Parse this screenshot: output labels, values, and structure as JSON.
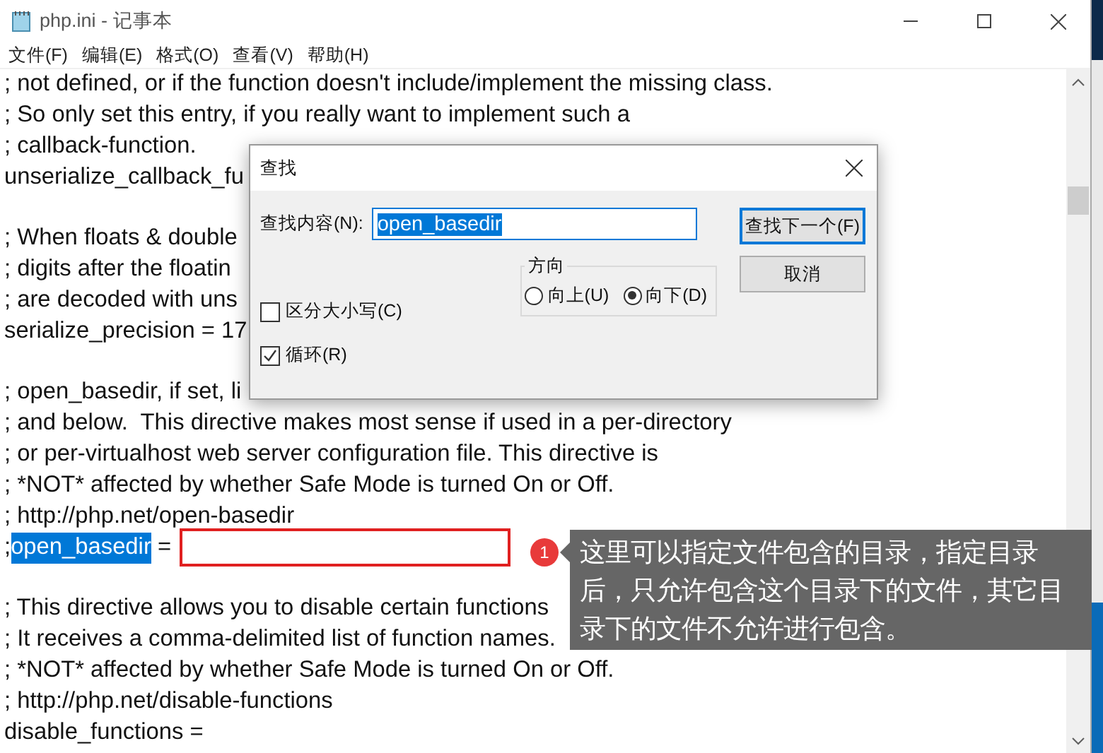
{
  "window": {
    "title": "php.ini - 记事本"
  },
  "menu": [
    "文件(F)",
    "编辑(E)",
    "格式(O)",
    "查看(V)",
    "帮助(H)"
  ],
  "lines": [
    {
      "kind": "text",
      "text": "; not defined, or if the function doesn't include/implement the missing class."
    },
    {
      "kind": "text",
      "text": "; So only set this entry, if you really want to implement such a"
    },
    {
      "kind": "text",
      "text": "; callback-function."
    },
    {
      "kind": "text",
      "text": "unserialize_callback_fu"
    },
    {
      "kind": "blank"
    },
    {
      "kind": "text",
      "text": "; When floats & double"
    },
    {
      "kind": "text",
      "text": "; digits after the floatin"
    },
    {
      "kind": "text",
      "text": "; are decoded with uns"
    },
    {
      "kind": "text",
      "text": "serialize_precision = 17"
    },
    {
      "kind": "blank"
    },
    {
      "kind": "text",
      "text": "; open_basedir, if set, li"
    },
    {
      "kind": "text",
      "text": "; and below.  This directive makes most sense if used in a per-directory"
    },
    {
      "kind": "text",
      "text": "; or per-virtualhost web server configuration file. This directive is"
    },
    {
      "kind": "text",
      "text": "; *NOT* affected by whether Safe Mode is turned On or Off."
    },
    {
      "kind": "text",
      "text": "; http://php.net/open-basedir"
    },
    {
      "kind": "match",
      "before": ";",
      "match": "open_basedir",
      "after": " ="
    },
    {
      "kind": "blank"
    },
    {
      "kind": "text",
      "text": "; This directive allows you to disable certain functions"
    },
    {
      "kind": "text",
      "text": "; It receives a comma-delimited list of function names."
    },
    {
      "kind": "text",
      "text": "; *NOT* affected by whether Safe Mode is turned On or Off."
    },
    {
      "kind": "text",
      "text": "; http://php.net/disable-functions"
    },
    {
      "kind": "text",
      "text": "disable_functions ="
    }
  ],
  "annotation": {
    "badge": "1",
    "note": "这里可以指定文件包含的目录，指定目录后，只允许包含这个目录下的文件，其它目录下的文件不允许进行包含。"
  },
  "find_dialog": {
    "title": "查找",
    "find_label": "查找内容(N):",
    "find_value": "open_basedir",
    "options": [
      {
        "label": "区分大小写(C)",
        "checked": false
      },
      {
        "label": "循环(R)",
        "checked": true
      }
    ],
    "direction": {
      "label": "方向",
      "choices": [
        {
          "label": "向上(U)",
          "selected": false
        },
        {
          "label": "向下(D)",
          "selected": true
        }
      ]
    },
    "buttons": [
      {
        "label": "查找下一个(F)",
        "default": true
      },
      {
        "label": "取消",
        "default": false
      }
    ]
  }
}
